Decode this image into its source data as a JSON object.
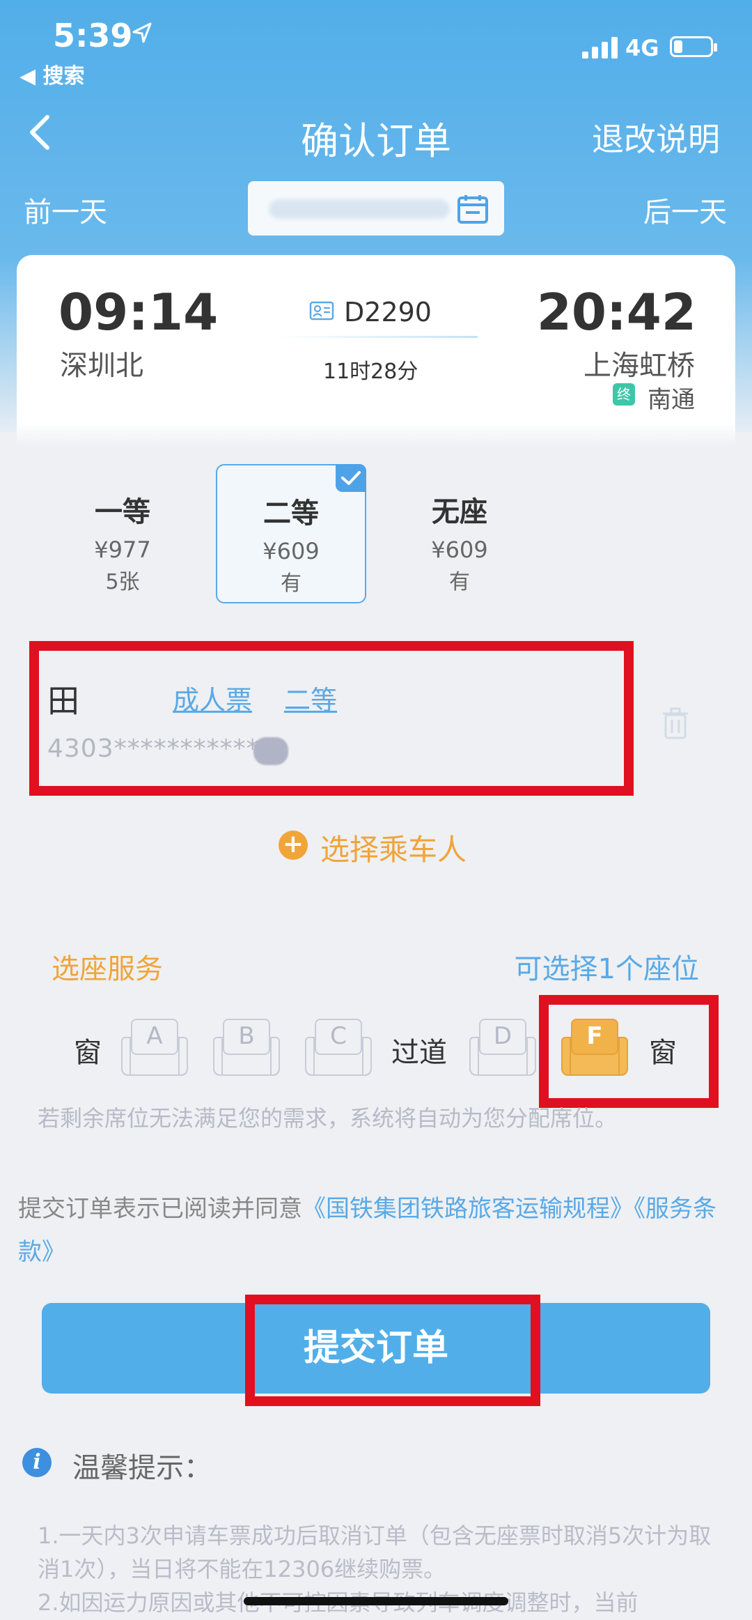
{
  "status_bar": {
    "time": "5:39",
    "back_app": "◀ 搜索",
    "network": "4G"
  },
  "nav": {
    "title": "确认订单",
    "right_action": "退改说明"
  },
  "date_bar": {
    "prev": "前一天",
    "next": "后一天"
  },
  "train": {
    "departure_time": "09:14",
    "departure_station": "深圳北",
    "arrival_time": "20:42",
    "arrival_station": "上海虹桥",
    "train_number": "D2290",
    "duration": "11时28分",
    "terminal_badge": "终",
    "terminal_station": "南通"
  },
  "seat_classes": [
    {
      "name": "一等",
      "price": "¥977",
      "availability": "5张"
    },
    {
      "name": "二等",
      "price": "¥609",
      "availability": "有"
    },
    {
      "name": "无座",
      "price": "¥609",
      "availability": "有"
    }
  ],
  "passenger": {
    "name": "田",
    "ticket_type": "成人票",
    "seat_class": "二等",
    "id_masked": "4303***********"
  },
  "add_passenger": {
    "icon": "+",
    "label": "选择乘车人"
  },
  "seat_service": {
    "title": "选座服务",
    "hint": "可选择1个座位",
    "labels": {
      "window_left": "窗",
      "aisle": "过道",
      "window_right": "窗"
    },
    "seats": [
      "A",
      "B",
      "C",
      "D",
      "F"
    ],
    "selected_seat": "F",
    "note": "若剩余席位无法满足您的需求，系统将自动为您分配席位。"
  },
  "agreement": {
    "prefix": "提交订单表示已阅读并同意",
    "link1": "《国铁集团铁路旅客运输规程》",
    "link2": "《服务条款》"
  },
  "submit_label": "提交订单",
  "tips": {
    "icon": "i",
    "title": "温馨提示：",
    "line1": "1.一天内3次申请车票成功后取消订单（包含无座票时取消5次计为取消1次），当日将不能在12306继续购票。",
    "line2": "2.如因运力原因或其他不可控因素导致列车调度调整时，当前"
  },
  "colors": {
    "accent": "#52aee9",
    "orange": "#f0a43a",
    "highlight": "#e01020"
  }
}
